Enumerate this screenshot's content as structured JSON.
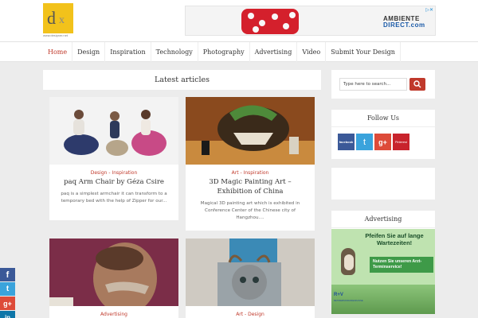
{
  "site": {
    "logo_letter_d": "d",
    "logo_letter_x": "x",
    "logo_tagline": "www.designer.net"
  },
  "banner": {
    "brand_line1": "AMBIENTE",
    "brand_line2": "DIRECT.com",
    "close_label": "▷✕"
  },
  "nav": {
    "items": [
      "Home",
      "Design",
      "Inspiration",
      "Technology",
      "Photography",
      "Advertising",
      "Video",
      "Submit Your Design"
    ],
    "active": "Home"
  },
  "main": {
    "section_title": "Latest articles",
    "cards": [
      {
        "category": "Design - Inspiration",
        "title": "paq Arm Chair by Géza Csire",
        "excerpt": "paq is a simplest armchair it can transform to a temporary bed with the help of Zipper for our..."
      },
      {
        "category": "Art - Inspiration",
        "title": "3D Magic Painting Art – Exhibition of China",
        "excerpt": "Magical 3D painting art which is exhibited in Conference Center of the Chinese city of Hangzhou...."
      },
      {
        "category": "Advertising",
        "title": "",
        "excerpt": ""
      },
      {
        "category": "Art - Design",
        "title": "",
        "excerpt": ""
      }
    ]
  },
  "sidebar": {
    "search_placeholder": "Type here to search...",
    "follow_title": "Follow Us",
    "social": {
      "facebook": "facebook",
      "twitter": "t",
      "googleplus": "g+",
      "pinterest": "Pinterest"
    },
    "advertising_title": "Advertising",
    "ad": {
      "headline": "Pfeifen Sie auf lange Wartezeiten!",
      "box": "Nutzen Sie unseren Arzt-Terminservice!",
      "logo": "R+V",
      "small": "BETRIEBSKRANKENKASSE"
    }
  },
  "share": {
    "facebook": "f",
    "twitter": "t",
    "googleplus": "g+",
    "linkedin": "in"
  },
  "colors": {
    "accent": "#c0392b",
    "facebook": "#3b5998",
    "twitter": "#3aa3dc",
    "googleplus": "#dd4b39",
    "linkedin": "#0e76a8",
    "logo_yellow": "#f2c21b"
  }
}
